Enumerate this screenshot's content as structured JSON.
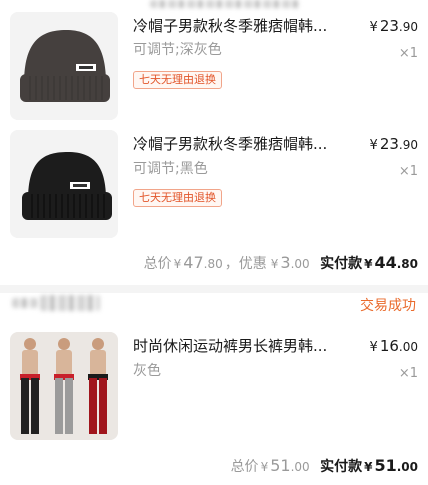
{
  "order1": {
    "items": [
      {
        "title": "冷帽子男款秋冬季雅痞帽韩...",
        "price_currency": "¥",
        "price_int": "23",
        "price_dec": ".90",
        "spec": "可调节;深灰色",
        "qty": "×1",
        "tag": "七天无理由退换",
        "hat_color": "#45403e"
      },
      {
        "title": "冷帽子男款秋冬季雅痞帽韩...",
        "price_currency": "¥",
        "price_int": "23",
        "price_dec": ".90",
        "spec": "可调节;黑色",
        "qty": "×1",
        "tag": "七天无理由退换",
        "hat_color": "#1c1c1c"
      }
    ],
    "summary": {
      "total_label": "总价",
      "total_currency": "¥",
      "total_int": "47",
      "total_dec": ".80",
      "discount_label": "，优惠",
      "discount_currency": "¥",
      "discount_int": "3",
      "discount_dec": ".00",
      "paid_label": "实付款",
      "paid_currency": "¥",
      "paid_int": "44",
      "paid_dec": ".80"
    }
  },
  "order2": {
    "status": "交易成功",
    "item": {
      "title": "时尚休闲运动裤男长裤男韩...",
      "price_currency": "¥",
      "price_int": "16",
      "price_dec": ".00",
      "spec": "灰色",
      "qty": "×1"
    },
    "summary": {
      "total_label": "总价",
      "total_currency": "¥",
      "total_int": "51",
      "total_dec": ".00",
      "paid_label": "实付款",
      "paid_currency": "¥",
      "paid_int": "51",
      "paid_dec": ".00"
    }
  },
  "colors": {
    "status_orange": "#ea6b2d",
    "tag_red": "#e2552a",
    "muted_text": "#9a9a9a"
  }
}
